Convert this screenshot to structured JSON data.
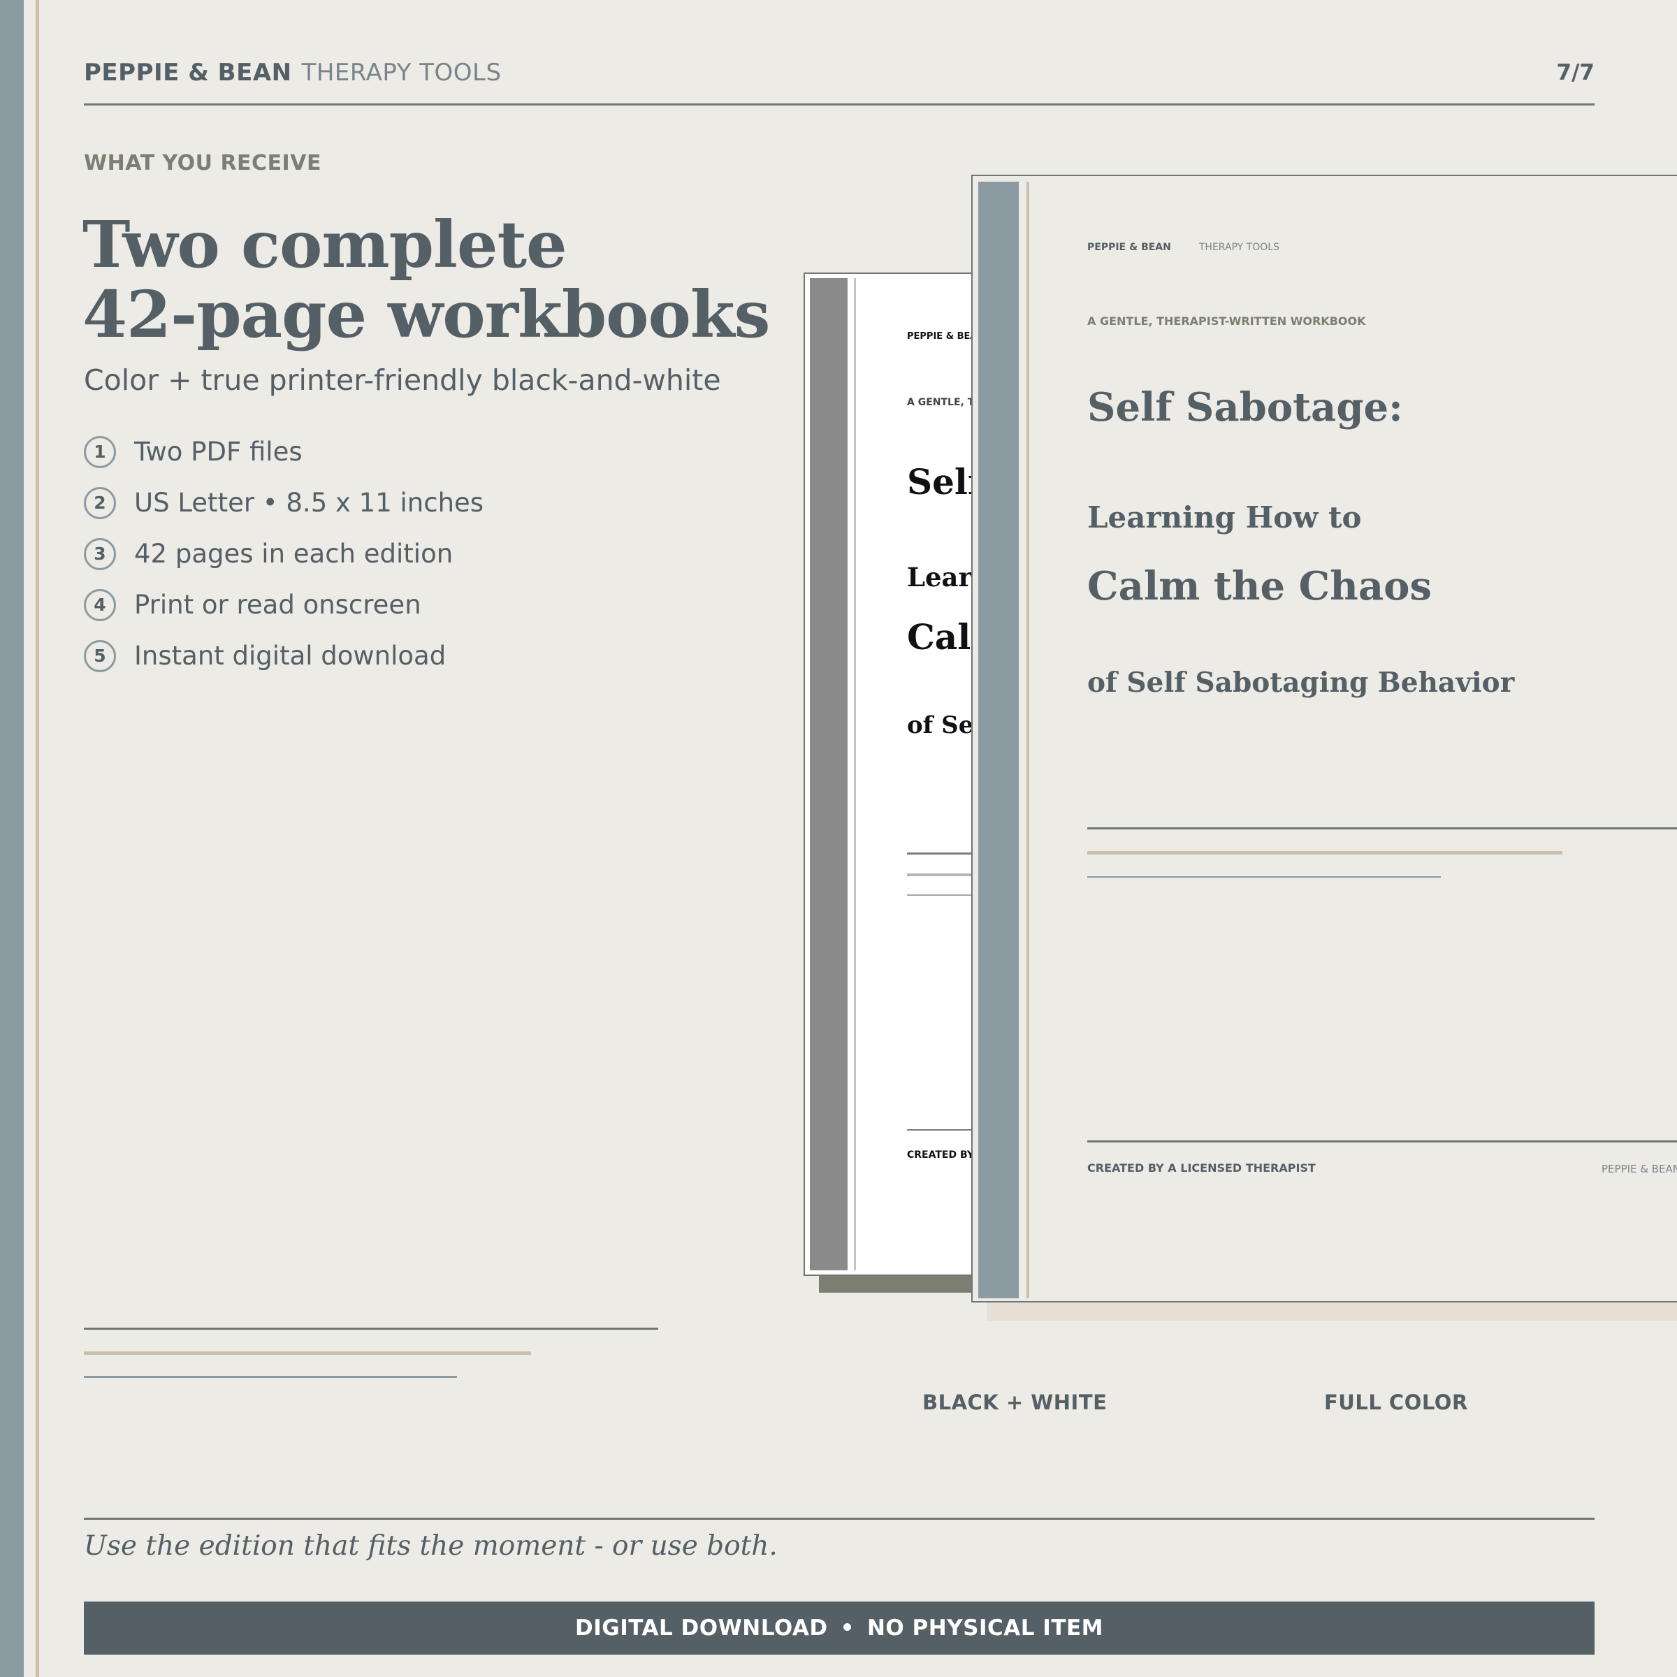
{
  "header": {
    "brand": "PEPPIE & BEAN",
    "brand_sub": "THERAPY TOOLS",
    "page_indicator": "7/7"
  },
  "main": {
    "eyebrow": "WHAT YOU RECEIVE",
    "headline_line1": "Two complete",
    "headline_line2": "42-page workbooks",
    "subhead": "Color + true printer-friendly black-and-white",
    "features": [
      {
        "num": "1",
        "text": "Two PDF files"
      },
      {
        "num": "2",
        "text": "US Letter • 8.5 x 11 inches"
      },
      {
        "num": "3",
        "text": "42 pages in each edition"
      },
      {
        "num": "4",
        "text": "Print or read onscreen"
      },
      {
        "num": "5",
        "text": "Instant digital download"
      }
    ]
  },
  "bw_edition": {
    "brand": "PEPPIE & BEAN",
    "eyebrow": "A GENTLE, TH",
    "title": "Self",
    "lead": "Learn",
    "big": "Calm",
    "tail": "of Sel",
    "footer": "CREATED BY",
    "caption": "BLACK + WHITE"
  },
  "color_edition": {
    "brand": "PEPPIE & BEAN",
    "brand_sub": "THERAPY TOOLS",
    "eyebrow": "A GENTLE, THERAPIST-WRITTEN WORKBOOK",
    "title": "Self Sabotage:",
    "lead": "Learning How to",
    "big": "Calm the Chaos",
    "tail": "of Self Sabotaging Behavior",
    "footer": "CREATED BY A LICENSED THERAPIST",
    "footer_right": "PEPPIE & BEAN",
    "caption": "FULL COLOR"
  },
  "footer": {
    "tagline": "Use the edition that fits the moment - or use both.",
    "banner_left": "DIGITAL DOWNLOAD",
    "banner_sep": "•",
    "banner_right": "NO PHYSICAL ITEM"
  },
  "colors": {
    "background": "#edebe6",
    "slate": "#545f66",
    "blue_gray": "#8c9ba2",
    "sand": "#cbbfae",
    "olive_gray": "#7a7f72"
  }
}
